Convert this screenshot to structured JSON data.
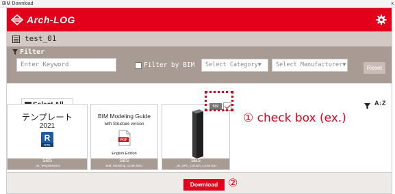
{
  "window": {
    "title": "BIM Download",
    "close": "x"
  },
  "header": {
    "brand": "Arch-LOG",
    "settings_icon": "gear-icon"
  },
  "project": {
    "name": "test_01",
    "icon": "list-icon"
  },
  "filter": {
    "title": "Filter",
    "keyword_placeholder": "Enter Keyword",
    "bim_label": "Filter by BIM",
    "category_placeholder": "Select Category▼",
    "manufacturer_placeholder": "Select Manufacturer▼",
    "reset_label": "Reset"
  },
  "toolbar": {
    "select_all_label": "Select All",
    "sort_label": "A↓Z"
  },
  "items": [
    {
      "title": "テンプレート",
      "subtitle": "2021",
      "icon": "revit-icon",
      "icon_text": "R",
      "icon_sub": "RTE",
      "footer_top": "SBS",
      "footer_bottom": "_ob_Template2021"
    },
    {
      "title": "BIM Modeling Guide",
      "subtitle": "with Structure version",
      "icon": "pdf-icon",
      "icon_text": "PDF",
      "extra": "English Edition",
      "footer_top": "SBS",
      "footer_bottom": "BIM_Modeling_Guide ENU"
    },
    {
      "icon": "column-icon",
      "badge": "BIM",
      "checked": true,
      "footer_top": "SBS",
      "footer_bottom": "_ob_SRC_Column_Cross-Box"
    }
  ],
  "annotations": {
    "checkbox_callout": "① check box (ex.)",
    "download_callout": "②"
  },
  "footer": {
    "download_label": "Download"
  },
  "colors": {
    "brand_red": "#e3001b",
    "filter_bg": "#a89b93",
    "project_bg": "#d4c9c2"
  }
}
